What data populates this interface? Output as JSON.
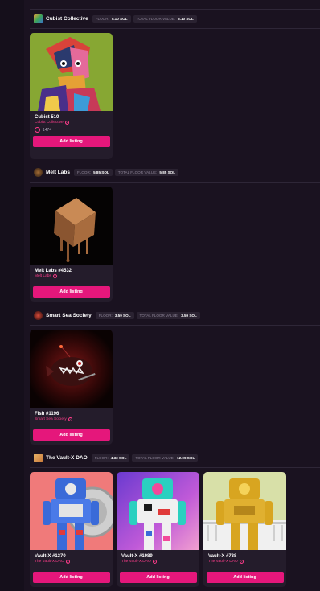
{
  "theme": {
    "accent": "#e5177b",
    "collection_text": "#ff3d8b",
    "background": "#1a1220",
    "card": "#241c2b"
  },
  "collections": [
    {
      "name": "Cubist Collective",
      "floor_label": "FLOOR:",
      "floor_value": "5.10 SOL",
      "total_label": "TOTAL FLOOR VALUE:",
      "total_value": "5.10 SOL",
      "items": [
        {
          "name": "Cubist 510",
          "collection": "Cubist Collective",
          "likes": "1474",
          "button": "Add listing"
        }
      ]
    },
    {
      "name": "Melt Labs",
      "floor_label": "FLOOR:",
      "floor_value": "5.85 SOL",
      "total_label": "TOTAL FLOOR VALUE:",
      "total_value": "5.85 SOL",
      "items": [
        {
          "name": "Melt Labs #4532",
          "collection": "Melt Labs",
          "button": "Add listing"
        }
      ]
    },
    {
      "name": "Smart Sea Society",
      "floor_label": "FLOOR:",
      "floor_value": "3.59 SOL",
      "total_label": "TOTAL FLOOR VALUE:",
      "total_value": "3.59 SOL",
      "items": [
        {
          "name": "Fish #1196",
          "collection": "Smart Sea Society",
          "button": "Add listing"
        }
      ]
    },
    {
      "name": "The Vault-X DAO",
      "floor_label": "FLOOR:",
      "floor_value": "4.33 SOL",
      "total_label": "TOTAL FLOOR VALUE:",
      "total_value": "12.99 SOL",
      "items": [
        {
          "name": "Vault-X #1370",
          "collection": "The Vault-X DAO",
          "button": "Add listing"
        },
        {
          "name": "Vault-X #1989",
          "collection": "The Vault-X DAO",
          "button": "Add listing"
        },
        {
          "name": "Vault-X #738",
          "collection": "The Vault-X DAO",
          "button": "Add listing"
        }
      ]
    }
  ]
}
